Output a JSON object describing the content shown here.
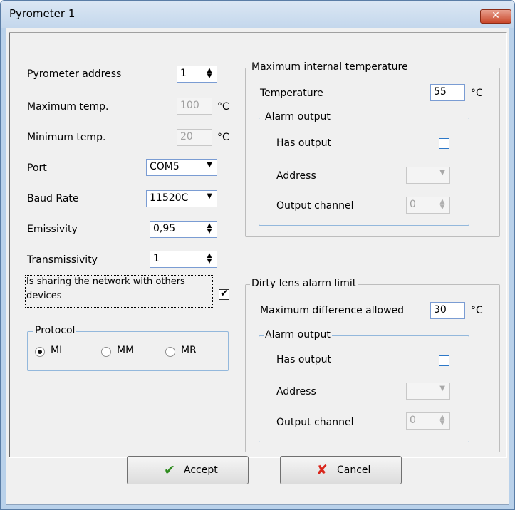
{
  "window": {
    "title": "Pyrometer 1",
    "close_glyph": "✕"
  },
  "left": {
    "pyrometer_address": {
      "label": "Pyrometer address",
      "value": "1"
    },
    "max_temp": {
      "label": "Maximum temp.",
      "value": "100",
      "unit": "°C"
    },
    "min_temp": {
      "label": "Minimum temp.",
      "value": "20",
      "unit": "°C"
    },
    "port": {
      "label": "Port",
      "value": "COM5"
    },
    "baud_rate": {
      "label": "Baud Rate",
      "value": "11520C"
    },
    "emissivity": {
      "label": "Emissivity",
      "value": "0,95"
    },
    "transmissivity": {
      "label": "Transmissivity",
      "value": "1"
    },
    "sharing": {
      "label_line1": "Is sharing the network with others",
      "label_line2": "devices",
      "checked": true
    },
    "protocol": {
      "legend": "Protocol",
      "options": [
        "MI",
        "MM",
        "MR"
      ],
      "selected": "MI"
    }
  },
  "max_internal": {
    "legend": "Maximum internal temperature",
    "temperature": {
      "label": "Temperature",
      "value": "55",
      "unit": "°C"
    },
    "alarm": {
      "legend": "Alarm output",
      "has_output_label": "Has output",
      "address_label": "Address",
      "channel_label": "Output channel",
      "channel_value": "0"
    }
  },
  "dirty_lens": {
    "legend": "Dirty lens alarm limit",
    "max_diff": {
      "label": "Maximum difference allowed",
      "value": "30",
      "unit": "°C"
    },
    "alarm": {
      "legend": "Alarm output",
      "has_output_label": "Has output",
      "address_label": "Address",
      "channel_label": "Output channel",
      "channel_value": "0"
    }
  },
  "buttons": {
    "accept": "Accept",
    "cancel": "Cancel"
  },
  "colors": {
    "accept_icon": "#2e8b1e",
    "cancel_icon": "#d9261c",
    "title_bar": "#c4d7ec"
  }
}
